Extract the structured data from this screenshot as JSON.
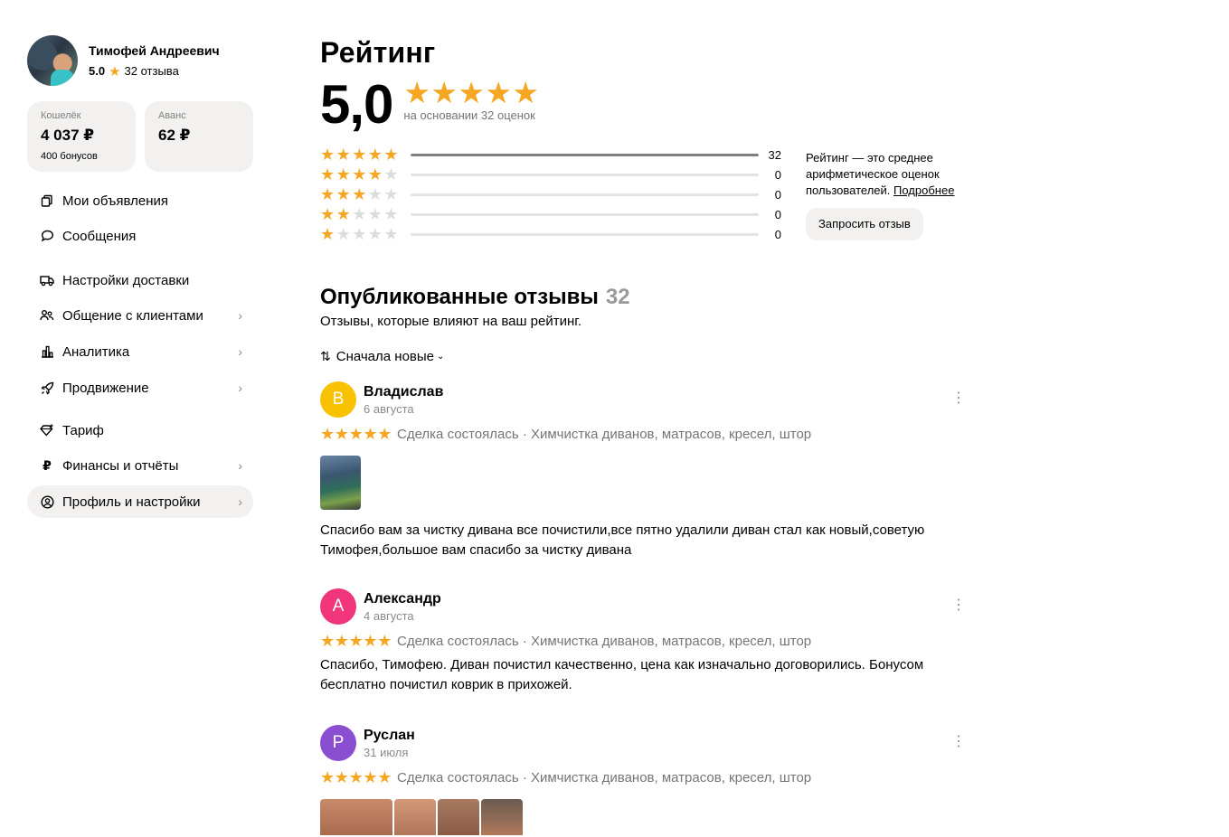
{
  "profile": {
    "name": "Тимофей Андреевич",
    "rating": "5.0",
    "reviews_count": "32 отзыва"
  },
  "wallets": [
    {
      "label": "Кошелёк",
      "amount": "4 037 ₽",
      "sub": "400 бонусов"
    },
    {
      "label": "Аванс",
      "amount": "62 ₽",
      "sub": ""
    }
  ],
  "menu": [
    {
      "label": "Мои объявления",
      "icon": "listings-icon",
      "chevron": false
    },
    {
      "label": "Сообщения",
      "icon": "chat-icon",
      "chevron": false
    },
    {
      "label": "Настройки доставки",
      "icon": "truck-icon",
      "chevron": false
    },
    {
      "label": "Общение с клиентами",
      "icon": "people-icon",
      "chevron": true
    },
    {
      "label": "Аналитика",
      "icon": "chart-icon",
      "chevron": true
    },
    {
      "label": "Продвижение",
      "icon": "rocket-icon",
      "chevron": true
    },
    {
      "label": "Тариф",
      "icon": "diamond-icon",
      "chevron": false
    },
    {
      "label": "Финансы и отчёты",
      "icon": "ruble-icon",
      "chevron": true
    },
    {
      "label": "Профиль и настройки",
      "icon": "user-circle-icon",
      "chevron": true,
      "active": true
    }
  ],
  "rating": {
    "title": "Рейтинг",
    "score": "5,0",
    "stars": 5,
    "based_on": "на основании 32 оценок",
    "distribution": [
      {
        "stars": 5,
        "count": "32",
        "fraction": 1.0
      },
      {
        "stars": 4,
        "count": "0",
        "fraction": 0
      },
      {
        "stars": 3,
        "count": "0",
        "fraction": 0
      },
      {
        "stars": 2,
        "count": "0",
        "fraction": 0
      },
      {
        "stars": 1,
        "count": "0",
        "fraction": 0
      }
    ],
    "note": "Рейтинг — это среднее арифметическое оценок пользователей.",
    "note_link": "Подробнее",
    "request_button": "Запросить отзыв"
  },
  "reviews": {
    "title": "Опубликованные отзывы",
    "count": "32",
    "subtitle": "Отзывы, которые влияют на ваш рейтинг.",
    "sort_label": "Сначала новые",
    "items": [
      {
        "initial": "В",
        "avatar_color": "#f8c200",
        "name": "Владислав",
        "date": "6 августа",
        "stars": 5,
        "meta": "Сделка состоялась · Химчистка диванов, матрасов, кресел, штор",
        "text": "Спасибо вам за чистку дивана все почистили,все пятно удалили диван стал как новый,советую Тимофея,большое вам спасибо за чистку дивана",
        "has_photo": true
      },
      {
        "initial": "А",
        "avatar_color": "#f0357b",
        "name": "Александр",
        "date": "4 августа",
        "stars": 5,
        "meta": "Сделка состоялась · Химчистка диванов, матрасов, кресел, штор",
        "text": "Спасибо, Тимофею. Диван почистил качественно, цена как изначально договорились. Бонусом бесплатно почистил коврик в прихожей.",
        "has_photo": false
      },
      {
        "initial": "Р",
        "avatar_color": "#8a4fd0",
        "name": "Руслан",
        "date": "31 июля",
        "stars": 5,
        "meta": "Сделка состоялась · Химчистка диванов, матрасов, кресел, штор",
        "text": "",
        "has_photo": false
      }
    ]
  },
  "colors": {
    "star": "#f5a623",
    "star_off": "#dcdcdc",
    "surface": "#f2f1f0",
    "muted": "#757575"
  }
}
